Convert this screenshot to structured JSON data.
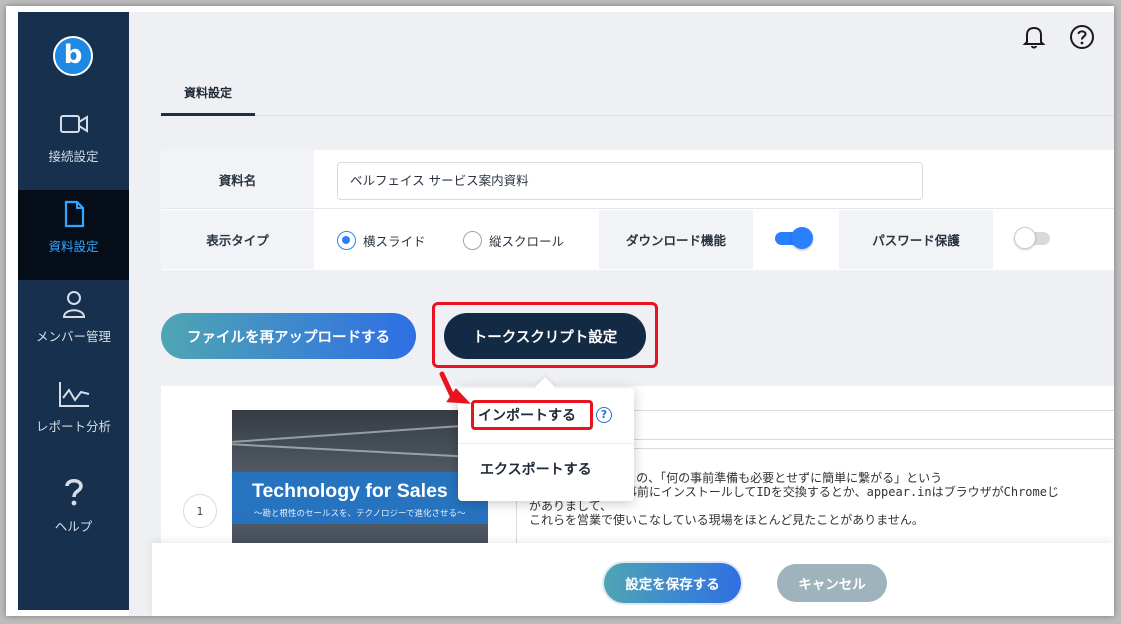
{
  "sidebar": {
    "logo": "b",
    "items": [
      {
        "label": "接続設定",
        "icon": "video-camera-icon"
      },
      {
        "label": "資料設定",
        "icon": "document-icon",
        "active": true
      },
      {
        "label": "メンバー管理",
        "icon": "user-icon"
      },
      {
        "label": "レポート分析",
        "icon": "chart-line-icon"
      },
      {
        "label": "ヘルプ",
        "icon": "question-icon"
      }
    ]
  },
  "header": {
    "tab": "資料設定"
  },
  "form": {
    "name_label": "資料名",
    "name_value": "ベルフェイス サービス案内資料",
    "display_type_label": "表示タイプ",
    "radio_horizontal": "横スライド",
    "radio_vertical": "縦スクロール",
    "download_label": "ダウンロード機能",
    "password_label": "パスワード保護"
  },
  "actions": {
    "reupload": "ファイルを再アップロードする",
    "talkscript": "トークスクリプト設定"
  },
  "dropdown": {
    "import": "インポートする",
    "help_glyph": "?",
    "export": "エクスポートする"
  },
  "slide": {
    "number": "1",
    "title": "Technology for Sales",
    "subtitle": "～勘と根性のセールスを、テクノロジーで進化させる～",
    "script": "ードにて]\nできるんですね！この、「何の事前準備も必要とせずに簡単に繋がる」という\n例えばスカイプは事前にインストールしてIDを交換するとか、appear.inはブラウザがChromeじ\nがありまして、\nこれらを営業で使いこなしている現場をほとんど見たことがありません。"
  },
  "footer": {
    "save": "設定を保存する",
    "cancel": "キャンセル"
  },
  "colors": {
    "sidebar": "#16304d",
    "active": "#35a6ff",
    "highlight": "#e8131f",
    "toggle_on": "#2a7fff"
  }
}
